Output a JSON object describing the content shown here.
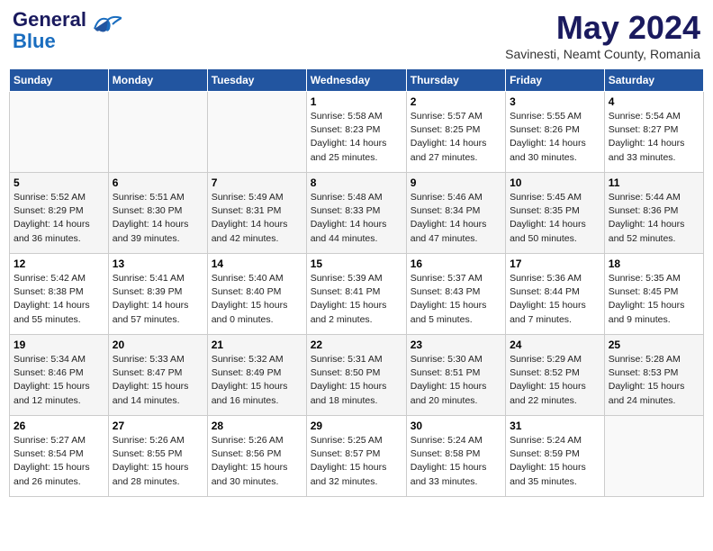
{
  "header": {
    "logo_line1": "General",
    "logo_line2": "Blue",
    "month_year": "May 2024",
    "location": "Savinesti, Neamt County, Romania"
  },
  "weekdays": [
    "Sunday",
    "Monday",
    "Tuesday",
    "Wednesday",
    "Thursday",
    "Friday",
    "Saturday"
  ],
  "weeks": [
    [
      {
        "day": "",
        "info": ""
      },
      {
        "day": "",
        "info": ""
      },
      {
        "day": "",
        "info": ""
      },
      {
        "day": "1",
        "info": "Sunrise: 5:58 AM\nSunset: 8:23 PM\nDaylight: 14 hours\nand 25 minutes."
      },
      {
        "day": "2",
        "info": "Sunrise: 5:57 AM\nSunset: 8:25 PM\nDaylight: 14 hours\nand 27 minutes."
      },
      {
        "day": "3",
        "info": "Sunrise: 5:55 AM\nSunset: 8:26 PM\nDaylight: 14 hours\nand 30 minutes."
      },
      {
        "day": "4",
        "info": "Sunrise: 5:54 AM\nSunset: 8:27 PM\nDaylight: 14 hours\nand 33 minutes."
      }
    ],
    [
      {
        "day": "5",
        "info": "Sunrise: 5:52 AM\nSunset: 8:29 PM\nDaylight: 14 hours\nand 36 minutes."
      },
      {
        "day": "6",
        "info": "Sunrise: 5:51 AM\nSunset: 8:30 PM\nDaylight: 14 hours\nand 39 minutes."
      },
      {
        "day": "7",
        "info": "Sunrise: 5:49 AM\nSunset: 8:31 PM\nDaylight: 14 hours\nand 42 minutes."
      },
      {
        "day": "8",
        "info": "Sunrise: 5:48 AM\nSunset: 8:33 PM\nDaylight: 14 hours\nand 44 minutes."
      },
      {
        "day": "9",
        "info": "Sunrise: 5:46 AM\nSunset: 8:34 PM\nDaylight: 14 hours\nand 47 minutes."
      },
      {
        "day": "10",
        "info": "Sunrise: 5:45 AM\nSunset: 8:35 PM\nDaylight: 14 hours\nand 50 minutes."
      },
      {
        "day": "11",
        "info": "Sunrise: 5:44 AM\nSunset: 8:36 PM\nDaylight: 14 hours\nand 52 minutes."
      }
    ],
    [
      {
        "day": "12",
        "info": "Sunrise: 5:42 AM\nSunset: 8:38 PM\nDaylight: 14 hours\nand 55 minutes."
      },
      {
        "day": "13",
        "info": "Sunrise: 5:41 AM\nSunset: 8:39 PM\nDaylight: 14 hours\nand 57 minutes."
      },
      {
        "day": "14",
        "info": "Sunrise: 5:40 AM\nSunset: 8:40 PM\nDaylight: 15 hours\nand 0 minutes."
      },
      {
        "day": "15",
        "info": "Sunrise: 5:39 AM\nSunset: 8:41 PM\nDaylight: 15 hours\nand 2 minutes."
      },
      {
        "day": "16",
        "info": "Sunrise: 5:37 AM\nSunset: 8:43 PM\nDaylight: 15 hours\nand 5 minutes."
      },
      {
        "day": "17",
        "info": "Sunrise: 5:36 AM\nSunset: 8:44 PM\nDaylight: 15 hours\nand 7 minutes."
      },
      {
        "day": "18",
        "info": "Sunrise: 5:35 AM\nSunset: 8:45 PM\nDaylight: 15 hours\nand 9 minutes."
      }
    ],
    [
      {
        "day": "19",
        "info": "Sunrise: 5:34 AM\nSunset: 8:46 PM\nDaylight: 15 hours\nand 12 minutes."
      },
      {
        "day": "20",
        "info": "Sunrise: 5:33 AM\nSunset: 8:47 PM\nDaylight: 15 hours\nand 14 minutes."
      },
      {
        "day": "21",
        "info": "Sunrise: 5:32 AM\nSunset: 8:49 PM\nDaylight: 15 hours\nand 16 minutes."
      },
      {
        "day": "22",
        "info": "Sunrise: 5:31 AM\nSunset: 8:50 PM\nDaylight: 15 hours\nand 18 minutes."
      },
      {
        "day": "23",
        "info": "Sunrise: 5:30 AM\nSunset: 8:51 PM\nDaylight: 15 hours\nand 20 minutes."
      },
      {
        "day": "24",
        "info": "Sunrise: 5:29 AM\nSunset: 8:52 PM\nDaylight: 15 hours\nand 22 minutes."
      },
      {
        "day": "25",
        "info": "Sunrise: 5:28 AM\nSunset: 8:53 PM\nDaylight: 15 hours\nand 24 minutes."
      }
    ],
    [
      {
        "day": "26",
        "info": "Sunrise: 5:27 AM\nSunset: 8:54 PM\nDaylight: 15 hours\nand 26 minutes."
      },
      {
        "day": "27",
        "info": "Sunrise: 5:26 AM\nSunset: 8:55 PM\nDaylight: 15 hours\nand 28 minutes."
      },
      {
        "day": "28",
        "info": "Sunrise: 5:26 AM\nSunset: 8:56 PM\nDaylight: 15 hours\nand 30 minutes."
      },
      {
        "day": "29",
        "info": "Sunrise: 5:25 AM\nSunset: 8:57 PM\nDaylight: 15 hours\nand 32 minutes."
      },
      {
        "day": "30",
        "info": "Sunrise: 5:24 AM\nSunset: 8:58 PM\nDaylight: 15 hours\nand 33 minutes."
      },
      {
        "day": "31",
        "info": "Sunrise: 5:24 AM\nSunset: 8:59 PM\nDaylight: 15 hours\nand 35 minutes."
      },
      {
        "day": "",
        "info": ""
      }
    ]
  ]
}
